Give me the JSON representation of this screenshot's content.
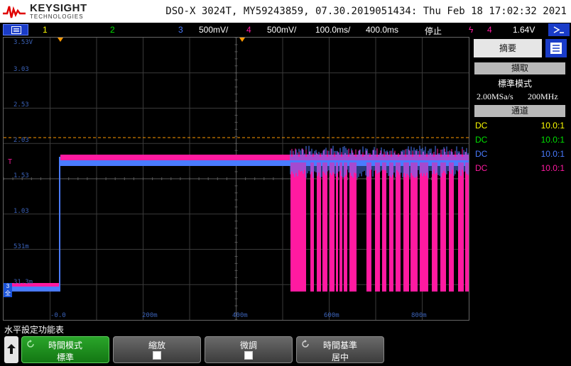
{
  "header": {
    "brand": "KEYSIGHT",
    "brand_sub": "TECHNOLOGIES",
    "model_info": "DSO-X 3024T, MY59243859, 07.30.2019051434: Thu Feb 18 17:02:32 2021"
  },
  "status_bar": {
    "ch1_label": "1",
    "ch2_label": "2",
    "ch3_label": "3",
    "ch3_scale": "500mV/",
    "ch4_label": "4",
    "ch4_scale": "500mV/",
    "time_pos": "100.0ms/",
    "time_scale": "400.0ms",
    "run_state": "停止",
    "trig_channel": "4",
    "trig_level": "1.64V"
  },
  "scope": {
    "y_labels": [
      "3.53V",
      "3.03",
      "2.53",
      "2.03",
      "1.53",
      "1.03",
      "531m",
      "31.3m"
    ],
    "x_labels": [
      "-0.0",
      "200m",
      "400m",
      "600m",
      "800m"
    ],
    "trig_marker": "T",
    "gnd_marker_line1": "3",
    "gnd_marker_line2": "全"
  },
  "panel": {
    "tab_label": "摘要",
    "acq_header": "擷取",
    "acq_mode": "標準模式",
    "sample_rate": "2.00MSa/s",
    "bandwidth": "200MHz",
    "channels_header": "通道",
    "channels": [
      {
        "coupling": "DC",
        "probe": "10.0:1",
        "color": "#ffff00"
      },
      {
        "coupling": "DC",
        "probe": "10.0:1",
        "color": "#00e000"
      },
      {
        "coupling": "DC",
        "probe": "10.0:1",
        "color": "#4a7bff"
      },
      {
        "coupling": "DC",
        "probe": "10.0:1",
        "color": "#ff1aa0"
      }
    ]
  },
  "softkeys": {
    "menu_title": "水平設定功能表",
    "time_mode_label": "時間模式",
    "time_mode_value": "標準",
    "zoom_label": "縮放",
    "fine_label": "微調",
    "time_ref_label": "時間基準",
    "time_ref_value": "居中"
  },
  "colors": {
    "ch1": "#ffff00",
    "ch2": "#00e000",
    "ch3": "#4a7bff",
    "ch4": "#ff1aa0",
    "trigger": "#ff9a00",
    "grid": "#3a3a3a"
  }
}
